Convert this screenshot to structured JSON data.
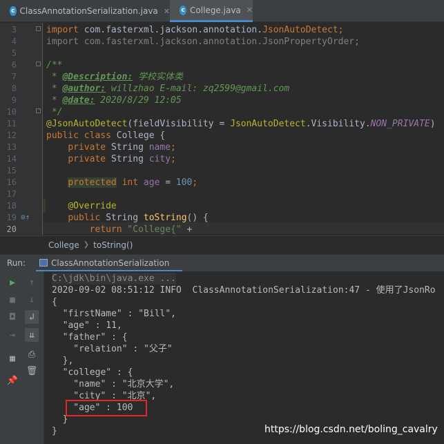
{
  "tabs": [
    {
      "label": "ClassAnnotationSerialization.java",
      "icon": "c",
      "close": "✕"
    },
    {
      "label": "College.java",
      "icon": "c",
      "close": "✕"
    }
  ],
  "editor": {
    "line_numbers": [
      "3",
      "4",
      "5",
      "6",
      "7",
      "8",
      "9",
      "10",
      "11",
      "12",
      "13",
      "14",
      "15",
      "16",
      "17",
      "18",
      "19",
      "20"
    ],
    "lines": [
      {
        "segments": [
          {
            "t": "import ",
            "c": "kw"
          },
          {
            "t": "com.fasterxml.jackson.annotation."
          },
          {
            "t": "JsonAutoDetect",
            "c": "kw"
          },
          {
            "t": ";",
            "c": "kw"
          }
        ]
      },
      {
        "segments": [
          {
            "t": "import com.fasterxml.jackson.annotation.JsonPropertyOrder;",
            "c": "dim"
          }
        ]
      },
      {
        "segments": []
      },
      {
        "segments": [
          {
            "t": "/**",
            "c": "cm"
          }
        ]
      },
      {
        "segments": [
          {
            "t": " * ",
            "c": "cm"
          },
          {
            "t": "@Description:",
            "c": "tag"
          },
          {
            "t": " 学校实体类",
            "c": "cm"
          }
        ]
      },
      {
        "segments": [
          {
            "t": " * ",
            "c": "cm"
          },
          {
            "t": "@author:",
            "c": "tag"
          },
          {
            "t": " willzhao E-mail: zq2599@gmail.com",
            "c": "cm"
          }
        ]
      },
      {
        "segments": [
          {
            "t": " * ",
            "c": "cm"
          },
          {
            "t": "@date:",
            "c": "tag"
          },
          {
            "t": " 2020/8/29 12:05",
            "c": "cm"
          }
        ]
      },
      {
        "segments": [
          {
            "t": " */",
            "c": "cm"
          }
        ]
      },
      {
        "segments": [
          {
            "t": "@JsonAutoDetect",
            "c": "ann"
          },
          {
            "t": "(fieldVisibility = "
          },
          {
            "t": "JsonAutoDetect",
            "c": "ann"
          },
          {
            "t": ".Visibility."
          },
          {
            "t": "NON_PRIVATE",
            "c": "ital"
          },
          {
            "t": ")"
          }
        ]
      },
      {
        "segments": [
          {
            "t": "public class ",
            "c": "kw"
          },
          {
            "t": "College {"
          }
        ]
      },
      {
        "segments": [
          {
            "t": "    "
          },
          {
            "t": "private ",
            "c": "kw"
          },
          {
            "t": "String "
          },
          {
            "t": "name",
            "c": "fld"
          },
          {
            "t": ";",
            "c": "kw"
          }
        ]
      },
      {
        "segments": [
          {
            "t": "    "
          },
          {
            "t": "private ",
            "c": "kw"
          },
          {
            "t": "String "
          },
          {
            "t": "city",
            "c": "fld"
          },
          {
            "t": ";",
            "c": "kw"
          }
        ]
      },
      {
        "segments": []
      },
      {
        "segments": [
          {
            "t": "    "
          },
          {
            "t": "protected",
            "c": "kw hlword"
          },
          {
            "t": " "
          },
          {
            "t": "int ",
            "c": "kw"
          },
          {
            "t": "age",
            "c": "fld"
          },
          {
            "t": " = "
          },
          {
            "t": "100",
            "c": "num"
          },
          {
            "t": ";",
            "c": "kw"
          }
        ]
      },
      {
        "segments": []
      },
      {
        "segments": [
          {
            "t": "    "
          },
          {
            "t": "@Override",
            "c": "ann"
          }
        ]
      },
      {
        "segments": [
          {
            "t": "    "
          },
          {
            "t": "public ",
            "c": "kw"
          },
          {
            "t": "String "
          },
          {
            "t": "toString",
            "c": "fn"
          },
          {
            "t": "() {"
          }
        ]
      },
      {
        "segments": [
          {
            "t": "        "
          },
          {
            "t": "return ",
            "c": "kw"
          },
          {
            "t": "\"College{\"",
            "c": "str"
          },
          {
            "t": " +"
          }
        ]
      }
    ]
  },
  "breadcrumb": [
    "College",
    "toString()"
  ],
  "run": {
    "label": "Run:",
    "tab_label": "ClassAnnotationSerialization",
    "console_lines": [
      "C:\\jdk\\bin\\java.exe ...",
      "2020-09-02 08:51:12 INFO  ClassAnnotationSerialization:47 - 使用了JsonRo",
      "{",
      "  \"firstName\" : \"Bill\",",
      "  \"age\" : 11,",
      "  \"father\" : {",
      "    \"relation\" : \"父子\"",
      "  },",
      "  \"college\" : {",
      "    \"name\" : \"北京大学\",",
      "    \"city\" : \"北京\",",
      "    \"age\" : 100",
      "  }",
      "}"
    ]
  },
  "watermark": "https://blog.csdn.net/boling_cavalry",
  "colors": {
    "highlight_box": "#e5262a",
    "accent": "#4a88c7"
  }
}
